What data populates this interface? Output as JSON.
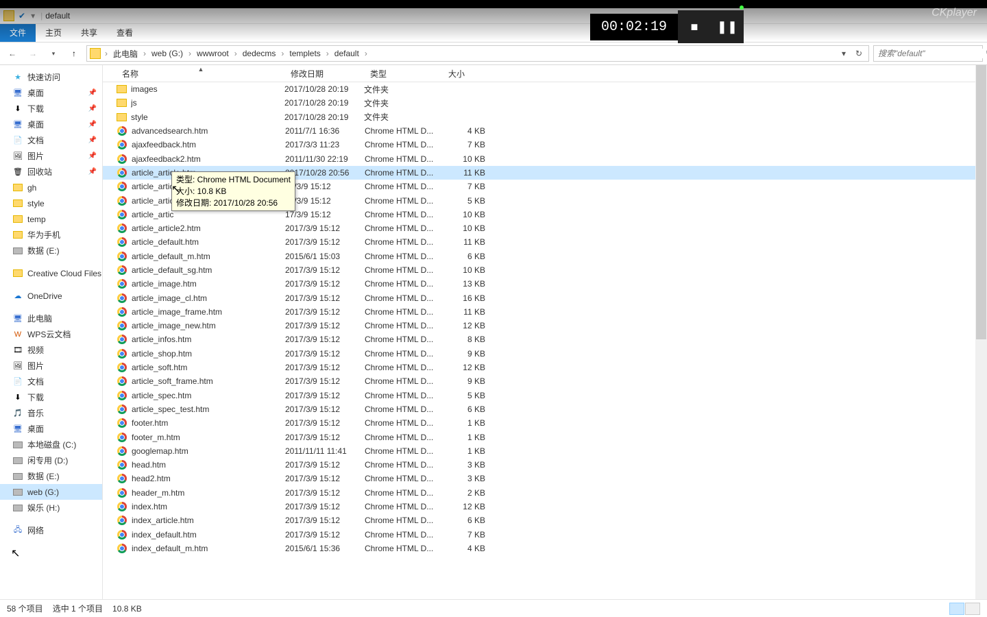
{
  "player": {
    "timer": "00:02:19",
    "brand": "CKplayer"
  },
  "titlebar": {
    "name": "default"
  },
  "ribbon": {
    "file": "文件",
    "home": "主页",
    "share": "共享",
    "view": "查看"
  },
  "nav": {
    "crumbs": [
      "此电脑",
      "web (G:)",
      "wwwroot",
      "dedecms",
      "templets",
      "default"
    ],
    "search_placeholder": "搜索\"default\""
  },
  "sidebar_groups": {
    "quick": "快速访问",
    "desktop": "桌面",
    "downloads": "下载",
    "desktop2": "桌面",
    "documents": "文档",
    "pictures": "图片",
    "recycle": "回收站",
    "gh": "gh",
    "style": "style",
    "temp": "temp",
    "huawei": "华为手机",
    "dataE": "数据 (E:)",
    "creative": "Creative Cloud Files",
    "onedrive": "OneDrive",
    "thispc": "此电脑",
    "wps": "WPS云文档",
    "videos": "视频",
    "pictures2": "图片",
    "documents2": "文档",
    "downloads2": "下载",
    "music": "音乐",
    "desktop3": "桌面",
    "cdrive": "本地磁盘 (C:)",
    "ddrive": "闲专用 (D:)",
    "edrive": "数据 (E:)",
    "gdrive": "web (G:)",
    "hdrive": "娱乐 (H:)",
    "network": "网络"
  },
  "columns": {
    "name": "名称",
    "date": "修改日期",
    "type": "类型",
    "size": "大小"
  },
  "files": [
    {
      "n": "images",
      "d": "2017/10/28 20:19",
      "t": "文件夹",
      "s": "",
      "k": "folder"
    },
    {
      "n": "js",
      "d": "2017/10/28 20:19",
      "t": "文件夹",
      "s": "",
      "k": "folder"
    },
    {
      "n": "style",
      "d": "2017/10/28 20:19",
      "t": "文件夹",
      "s": "",
      "k": "folder"
    },
    {
      "n": "advancedsearch.htm",
      "d": "2011/7/1 16:36",
      "t": "Chrome HTML D...",
      "s": "4 KB",
      "k": "chrome"
    },
    {
      "n": "ajaxfeedback.htm",
      "d": "2017/3/3 11:23",
      "t": "Chrome HTML D...",
      "s": "7 KB",
      "k": "chrome"
    },
    {
      "n": "ajaxfeedback2.htm",
      "d": "2011/11/30 22:19",
      "t": "Chrome HTML D...",
      "s": "10 KB",
      "k": "chrome"
    },
    {
      "n": "article_article.htm",
      "d": "2017/10/28 20:56",
      "t": "Chrome HTML D...",
      "s": "11 KB",
      "k": "chrome",
      "sel": true
    },
    {
      "n": "article_artic",
      "d": "17/3/9 15:12",
      "t": "Chrome HTML D...",
      "s": "7 KB",
      "k": "chrome"
    },
    {
      "n": "article_artic",
      "d": "17/3/9 15:12",
      "t": "Chrome HTML D...",
      "s": "5 KB",
      "k": "chrome"
    },
    {
      "n": "article_artic",
      "d": "17/3/9 15:12",
      "t": "Chrome HTML D...",
      "s": "10 KB",
      "k": "chrome"
    },
    {
      "n": "article_article2.htm",
      "d": "2017/3/9 15:12",
      "t": "Chrome HTML D...",
      "s": "10 KB",
      "k": "chrome"
    },
    {
      "n": "article_default.htm",
      "d": "2017/3/9 15:12",
      "t": "Chrome HTML D...",
      "s": "11 KB",
      "k": "chrome"
    },
    {
      "n": "article_default_m.htm",
      "d": "2015/6/1 15:03",
      "t": "Chrome HTML D...",
      "s": "6 KB",
      "k": "chrome"
    },
    {
      "n": "article_default_sg.htm",
      "d": "2017/3/9 15:12",
      "t": "Chrome HTML D...",
      "s": "10 KB",
      "k": "chrome"
    },
    {
      "n": "article_image.htm",
      "d": "2017/3/9 15:12",
      "t": "Chrome HTML D...",
      "s": "13 KB",
      "k": "chrome"
    },
    {
      "n": "article_image_cl.htm",
      "d": "2017/3/9 15:12",
      "t": "Chrome HTML D...",
      "s": "16 KB",
      "k": "chrome"
    },
    {
      "n": "article_image_frame.htm",
      "d": "2017/3/9 15:12",
      "t": "Chrome HTML D...",
      "s": "11 KB",
      "k": "chrome"
    },
    {
      "n": "article_image_new.htm",
      "d": "2017/3/9 15:12",
      "t": "Chrome HTML D...",
      "s": "12 KB",
      "k": "chrome"
    },
    {
      "n": "article_infos.htm",
      "d": "2017/3/9 15:12",
      "t": "Chrome HTML D...",
      "s": "8 KB",
      "k": "chrome"
    },
    {
      "n": "article_shop.htm",
      "d": "2017/3/9 15:12",
      "t": "Chrome HTML D...",
      "s": "9 KB",
      "k": "chrome"
    },
    {
      "n": "article_soft.htm",
      "d": "2017/3/9 15:12",
      "t": "Chrome HTML D...",
      "s": "12 KB",
      "k": "chrome"
    },
    {
      "n": "article_soft_frame.htm",
      "d": "2017/3/9 15:12",
      "t": "Chrome HTML D...",
      "s": "9 KB",
      "k": "chrome"
    },
    {
      "n": "article_spec.htm",
      "d": "2017/3/9 15:12",
      "t": "Chrome HTML D...",
      "s": "5 KB",
      "k": "chrome"
    },
    {
      "n": "article_spec_test.htm",
      "d": "2017/3/9 15:12",
      "t": "Chrome HTML D...",
      "s": "6 KB",
      "k": "chrome"
    },
    {
      "n": "footer.htm",
      "d": "2017/3/9 15:12",
      "t": "Chrome HTML D...",
      "s": "1 KB",
      "k": "chrome"
    },
    {
      "n": "footer_m.htm",
      "d": "2017/3/9 15:12",
      "t": "Chrome HTML D...",
      "s": "1 KB",
      "k": "chrome"
    },
    {
      "n": "googlemap.htm",
      "d": "2011/11/11 11:41",
      "t": "Chrome HTML D...",
      "s": "1 KB",
      "k": "chrome"
    },
    {
      "n": "head.htm",
      "d": "2017/3/9 15:12",
      "t": "Chrome HTML D...",
      "s": "3 KB",
      "k": "chrome"
    },
    {
      "n": "head2.htm",
      "d": "2017/3/9 15:12",
      "t": "Chrome HTML D...",
      "s": "3 KB",
      "k": "chrome"
    },
    {
      "n": "header_m.htm",
      "d": "2017/3/9 15:12",
      "t": "Chrome HTML D...",
      "s": "2 KB",
      "k": "chrome"
    },
    {
      "n": "index.htm",
      "d": "2017/3/9 15:12",
      "t": "Chrome HTML D...",
      "s": "12 KB",
      "k": "chrome"
    },
    {
      "n": "index_article.htm",
      "d": "2017/3/9 15:12",
      "t": "Chrome HTML D...",
      "s": "6 KB",
      "k": "chrome"
    },
    {
      "n": "index_default.htm",
      "d": "2017/3/9 15:12",
      "t": "Chrome HTML D...",
      "s": "7 KB",
      "k": "chrome"
    },
    {
      "n": "index_default_m.htm",
      "d": "2015/6/1 15:36",
      "t": "Chrome HTML D...",
      "s": "4 KB",
      "k": "chrome"
    }
  ],
  "tooltip": {
    "l1": "类型: Chrome HTML Document",
    "l2": "大小: 10.8 KB",
    "l3": "修改日期: 2017/10/28 20:56"
  },
  "status": {
    "count": "58 个项目",
    "selection": "选中 1 个项目",
    "size": "10.8 KB"
  }
}
